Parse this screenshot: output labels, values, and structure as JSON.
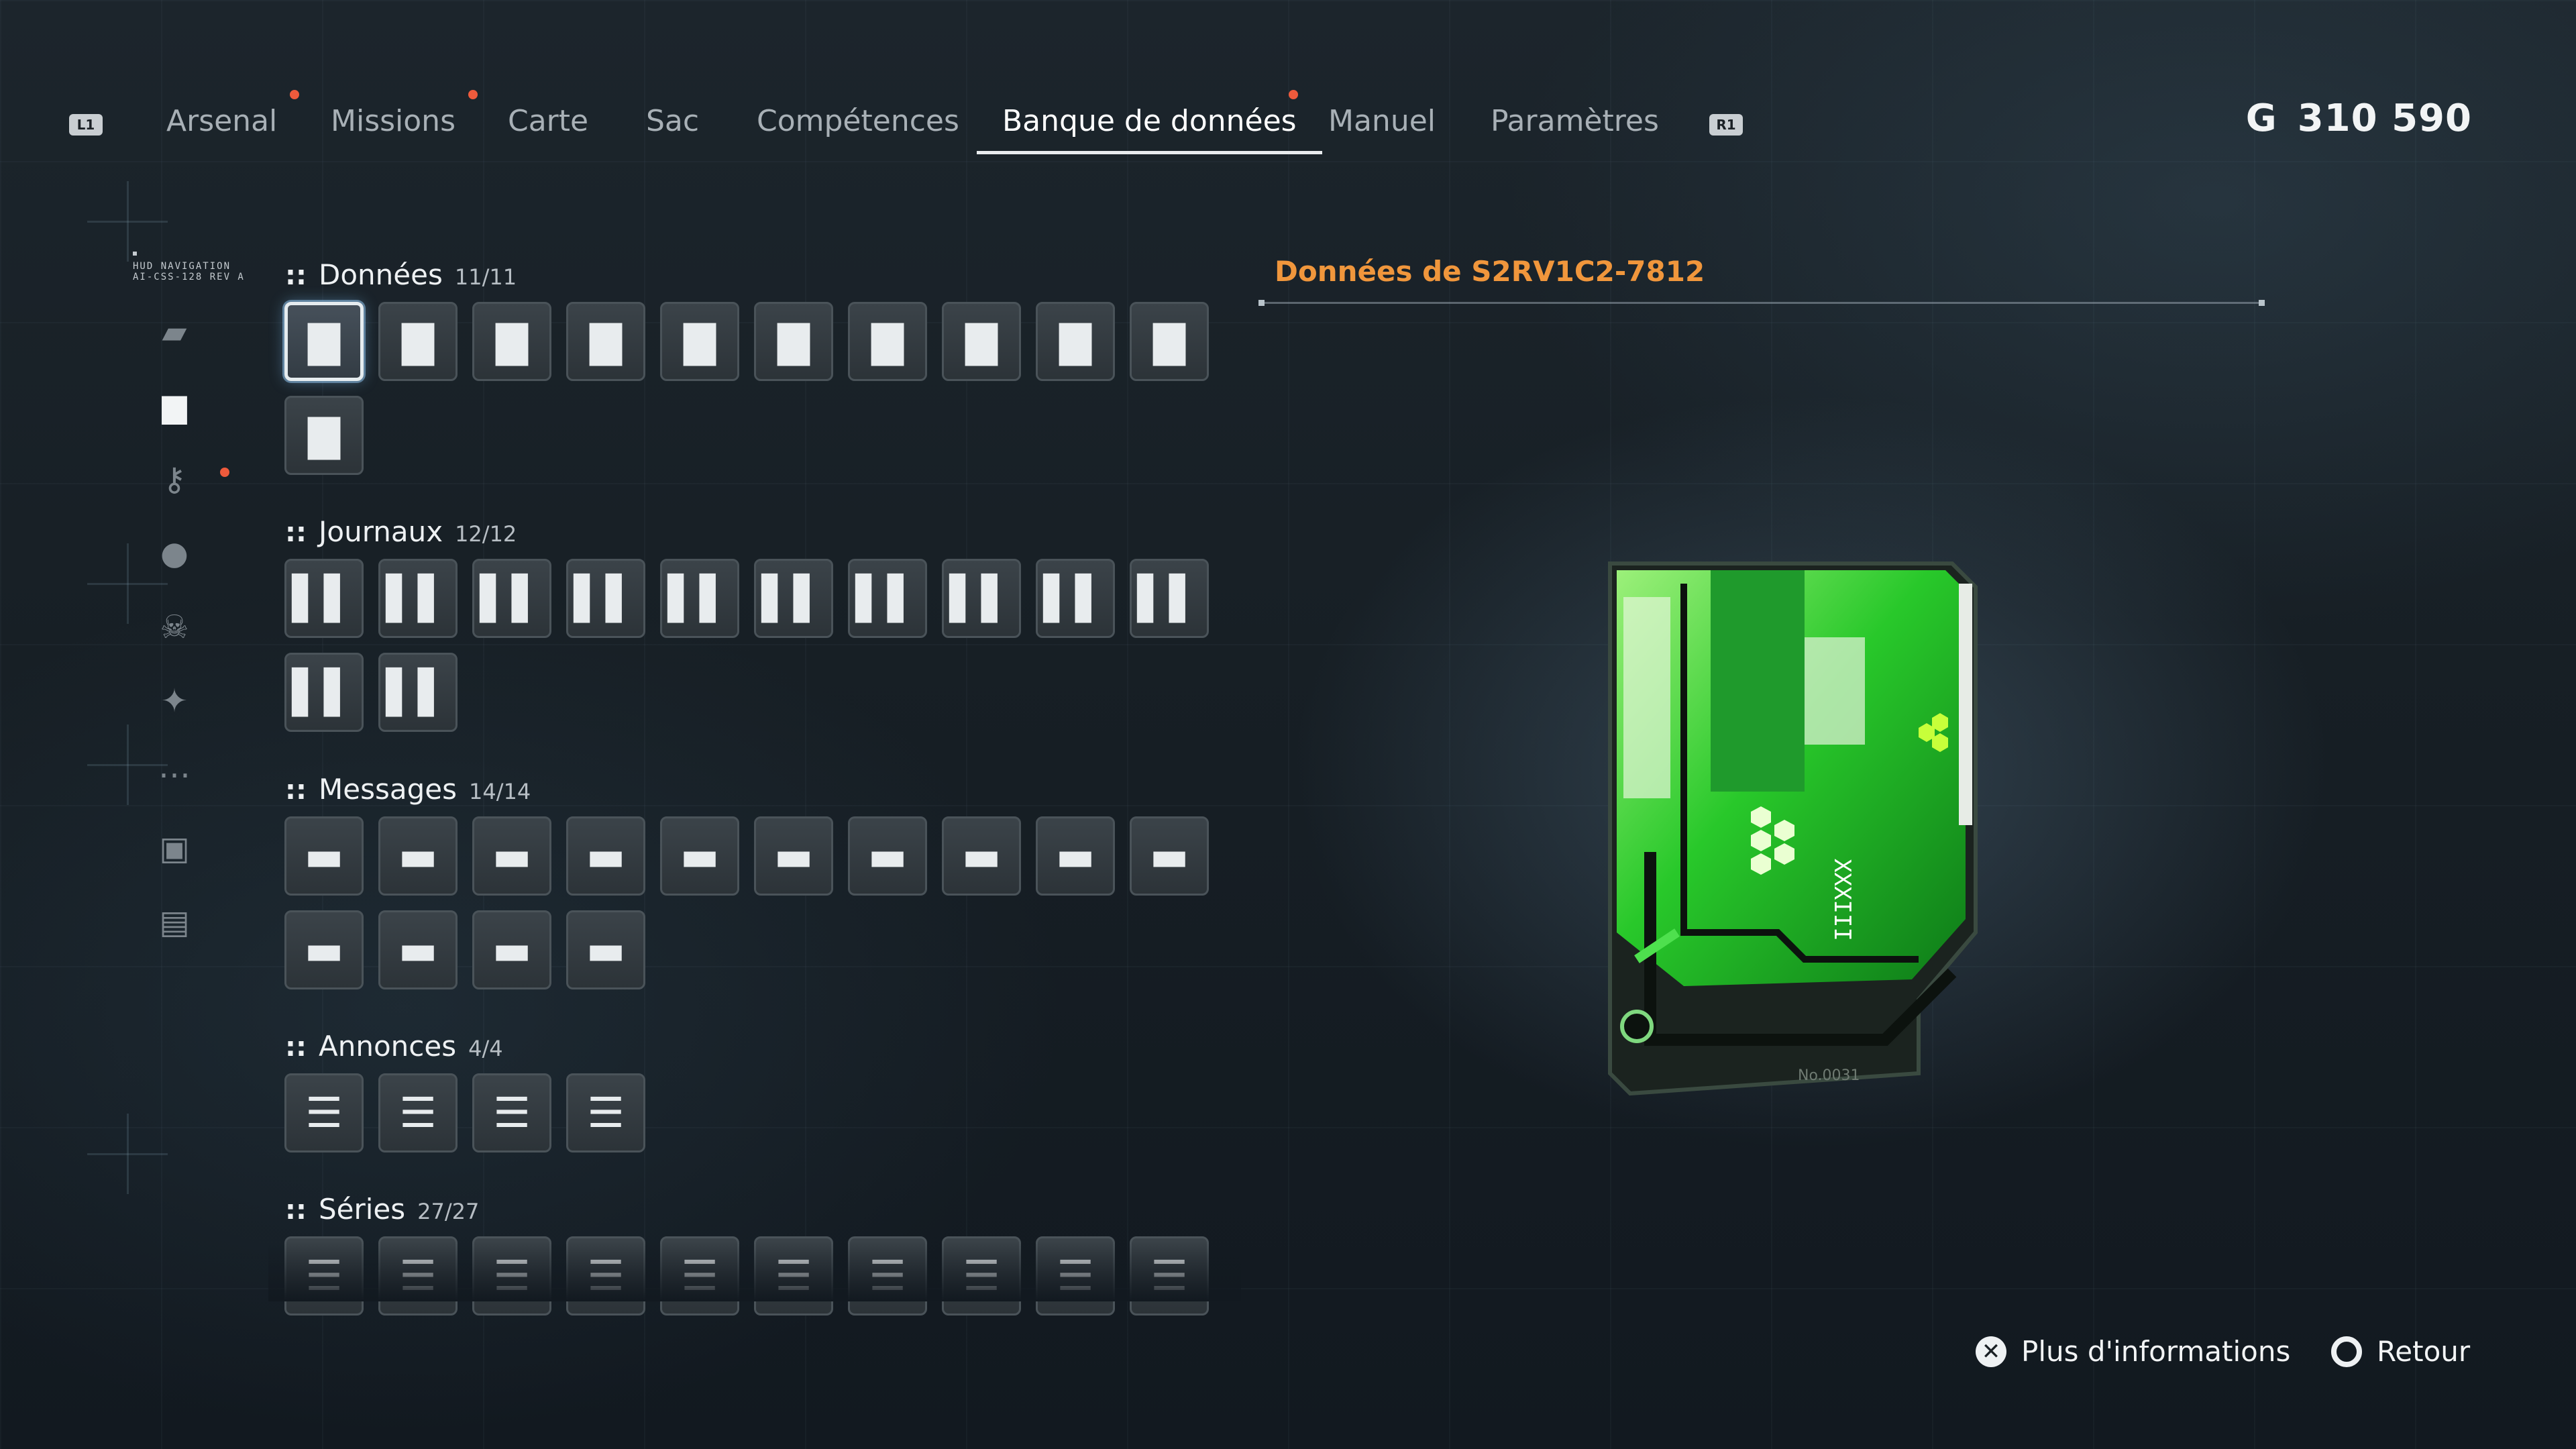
{
  "nav": {
    "left_shoulder": "L1",
    "right_shoulder": "R1",
    "tabs": [
      {
        "label": "Arsenal",
        "notify": true
      },
      {
        "label": "Missions",
        "notify": true
      },
      {
        "label": "Carte",
        "notify": false
      },
      {
        "label": "Sac",
        "notify": false
      },
      {
        "label": "Compétences",
        "notify": false
      },
      {
        "label": "Banque de données",
        "notify": true,
        "active": true
      },
      {
        "label": "Manuel",
        "notify": false
      },
      {
        "label": "Paramètres",
        "notify": false
      }
    ],
    "currency_symbol": "G",
    "currency_amount": "310 590"
  },
  "rail": {
    "label_line1": "HUD NAVIGATION",
    "label_line2": "AI-CSS-128 REV A",
    "icons": [
      {
        "name": "weapon-icon",
        "glyph": "▰",
        "active": false
      },
      {
        "name": "document-icon",
        "glyph": "▆",
        "active": true
      },
      {
        "name": "key-icon",
        "glyph": "⚷",
        "active": false,
        "notify": true
      },
      {
        "name": "person-icon",
        "glyph": "●",
        "active": false
      },
      {
        "name": "skull-icon",
        "glyph": "☠",
        "active": false
      },
      {
        "name": "fish-icon",
        "glyph": "✦",
        "active": false
      },
      {
        "name": "chat-icon",
        "glyph": "⋯",
        "active": false
      },
      {
        "name": "camera-icon",
        "glyph": "▣",
        "active": false
      },
      {
        "name": "card-icon",
        "glyph": "▤",
        "active": false
      }
    ]
  },
  "sections": [
    {
      "title": "Données",
      "count": "11/11",
      "glyph": "▇",
      "slots": 11
    },
    {
      "title": "Journaux",
      "count": "12/12",
      "glyph": "▌▌",
      "slots": 12
    },
    {
      "title": "Messages",
      "count": "14/14",
      "glyph": "▬",
      "slots": 14
    },
    {
      "title": "Annonces",
      "count": "4/4",
      "glyph": "☰",
      "slots": 4
    },
    {
      "title": "Séries",
      "count": "27/27",
      "glyph": "☰",
      "slots": 10
    }
  ],
  "detail": {
    "title": "Données de S2RV1C2-7812",
    "chip_text_1": "XXXIII",
    "chip_text_2": "No.0031"
  },
  "footer": {
    "info_button_glyph": "✕",
    "info_label": "Plus d'informations",
    "back_button_glyph": "",
    "back_label": "Retour"
  },
  "colors": {
    "accent_orange": "#f0963c",
    "notification_red": "#ee5a3c",
    "chip_green": "#2fcf2f"
  }
}
